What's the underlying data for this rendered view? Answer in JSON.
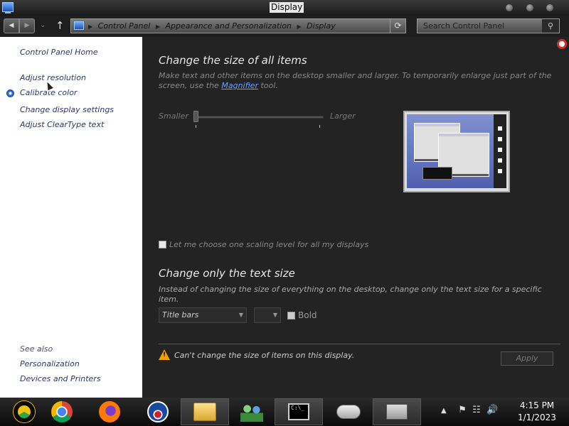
{
  "window": {
    "title": "Display"
  },
  "navbar": {
    "breadcrumbs": [
      "Control Panel",
      "Appearance and Personalization",
      "Display"
    ],
    "search_placeholder": "Search Control Panel"
  },
  "sidebar": {
    "home": "Control Panel Home",
    "links": [
      "Adjust resolution",
      "Calibrate color",
      "Change display settings",
      "Adjust ClearType text"
    ],
    "see_also_label": "See also",
    "see_also": [
      "Personalization",
      "Devices and Printers"
    ]
  },
  "main": {
    "section1_title": "Change the size of all items",
    "section1_desc_a": "Make text and other items on the desktop smaller and larger. To temporarily enlarge just part of the screen, use the ",
    "section1_desc_link": "Magnifier",
    "section1_desc_b": " tool.",
    "slider_min_label": "Smaller",
    "slider_max_label": "Larger",
    "scaling_checkbox_label": "Let me choose one scaling level for all my displays",
    "section2_title": "Change only the text size",
    "section2_desc": "Instead of changing the size of everything on the desktop, change only the text size for a specific item.",
    "item_select_value": "Title bars",
    "size_select_value": "",
    "bold_label": "Bold",
    "warning_text": "Can't change the size of items on this display.",
    "apply_label": "Apply"
  },
  "taskbar": {
    "apps": [
      "chrome-canary-icon",
      "chrome-icon",
      "firefox-icon",
      "obama-icon",
      "file-explorer-icon",
      "network-people-icon",
      "command-prompt-icon",
      "gamepad-icon",
      "control-panel-icon"
    ],
    "clock_time": "4:15 PM",
    "clock_date": "1/1/2023"
  }
}
